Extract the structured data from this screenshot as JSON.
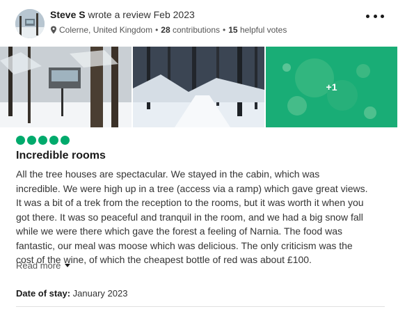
{
  "review": {
    "author": "Steve S",
    "action_text": "wrote a review Feb 2023",
    "location": "Colerne, United Kingdom",
    "contributions_count": "28",
    "contributions_label": "contributions",
    "helpful_count": "15",
    "helpful_label": "helpful votes",
    "more_menu_icon": "more-horizontal-icon",
    "photos": [
      {
        "name": "tree-house-cabin-snow"
      },
      {
        "name": "snowy-forest-path"
      },
      {
        "name": "aerial-forest-view",
        "more_label": "+1"
      }
    ],
    "rating": 5,
    "rating_max": 5,
    "rating_color": "#00aa6c",
    "title": "Incredible rooms",
    "body": [
      "All the tree houses are spectacular. We stayed in the cabin, which was",
      "incredible. We were high up in a tree (access via a ramp) which gave great views.",
      "It was a bit of a trek from the reception to the rooms, but it was worth it when you",
      "got there. It was so peaceful and tranquil in the room, and we had a big snow fall",
      "while we were there which gave the forest a feeling of Narnia. The food was",
      "fantastic, our meal was moose which was delicious. The only criticism was the",
      "cost of the wine, of which the cheapest bottle of red was about £100."
    ],
    "read_more_label": "Read more",
    "date_of_stay_label": "Date of stay:",
    "date_of_stay_value": "January 2023"
  }
}
